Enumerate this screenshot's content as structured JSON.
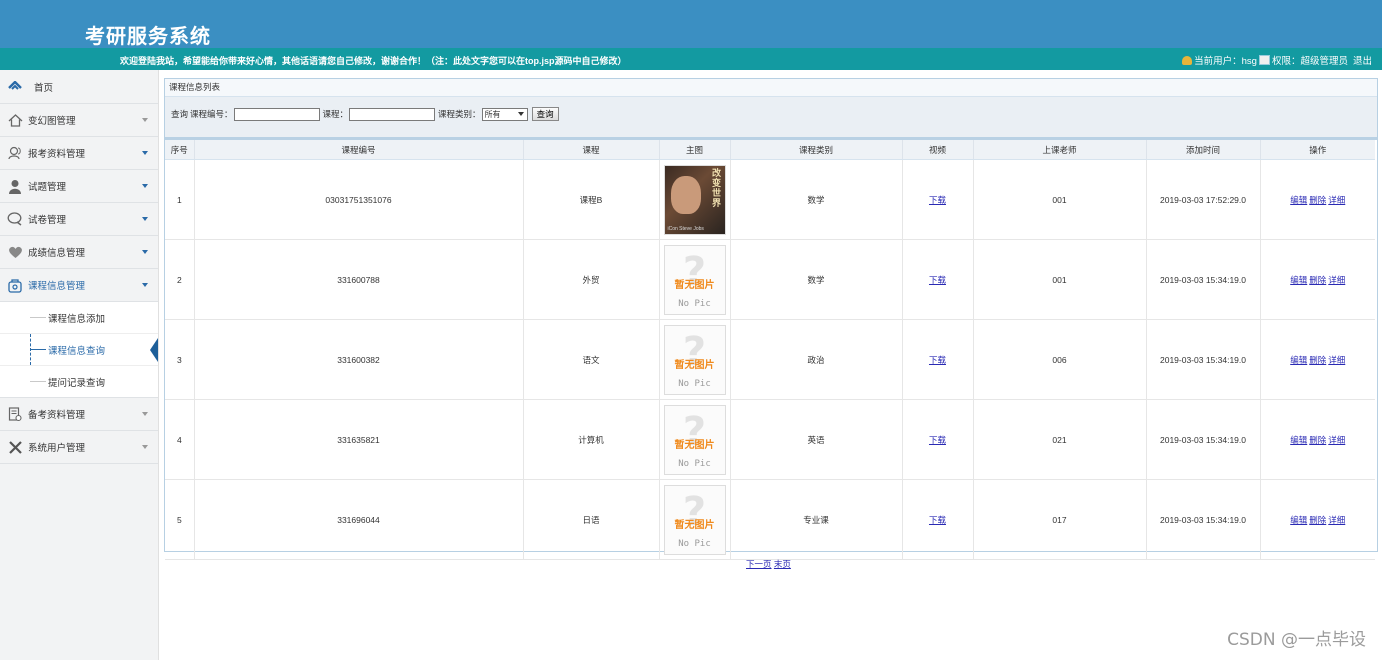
{
  "header": {
    "title": "考研服务系统",
    "welcome": "欢迎登陆我站，希望能给你带来好心情，其他话语请您自己修改，谢谢合作！（注：此处文字您可以在top.jsp源码中自己修改）",
    "user_text": "当前用户：hsg",
    "role_text": "权限：超级管理员",
    "logout": "退出"
  },
  "sidebar": {
    "home": "首页",
    "items": [
      {
        "label": "变幻图管理",
        "icon": "house-outline-icon"
      },
      {
        "label": "报考资料管理",
        "icon": "users-icon"
      },
      {
        "label": "试题管理",
        "icon": "person-icon"
      },
      {
        "label": "试卷管理",
        "icon": "chat-bubble-icon"
      },
      {
        "label": "成绩信息管理",
        "icon": "heart-icon"
      },
      {
        "label": "课程信息管理",
        "icon": "course-icon"
      },
      {
        "label": "备考资料管理",
        "icon": "document-icon"
      },
      {
        "label": "系统用户管理",
        "icon": "tools-icon"
      }
    ],
    "submenu": [
      "课程信息添加",
      "课程信息查询",
      "提问记录查询"
    ]
  },
  "panel": {
    "title": "课程信息列表",
    "search": {
      "query_label": "查询",
      "code_label": "课程编号：",
      "course_label": "课程：",
      "type_label": "课程类别：",
      "type_value": "所有",
      "button": "查询"
    }
  },
  "table": {
    "columns": [
      "序号",
      "课程编号",
      "课程",
      "主图",
      "课程类别",
      "视频",
      "上课老师",
      "添加时间",
      "操作"
    ],
    "rows": [
      {
        "no": "1",
        "code": "03031751351076",
        "course": "课程B",
        "type": "数学",
        "video": "下载",
        "teacher": "001",
        "time": "2019-03-03 17:52:29.0",
        "image": "photo"
      },
      {
        "no": "2",
        "code": "331600788",
        "course": "外贸",
        "type": "数学",
        "video": "下载",
        "teacher": "001",
        "time": "2019-03-03 15:34:19.0",
        "image": "nopic"
      },
      {
        "no": "3",
        "code": "331600382",
        "course": "语文",
        "type": "政治",
        "video": "下载",
        "teacher": "006",
        "time": "2019-03-03 15:34:19.0",
        "image": "nopic"
      },
      {
        "no": "4",
        "code": "331635821",
        "course": "计算机",
        "type": "英语",
        "video": "下载",
        "teacher": "021",
        "time": "2019-03-03 15:34:19.0",
        "image": "nopic"
      },
      {
        "no": "5",
        "code": "331696044",
        "course": "日语",
        "type": "专业课",
        "video": "下载",
        "teacher": "017",
        "time": "2019-03-03 15:34:19.0",
        "image": "nopic"
      }
    ],
    "actions": [
      "编辑",
      "删除",
      "详细"
    ],
    "photo_text": "改变世界",
    "photo_caption": "iCon Steve Jobs",
    "nopic_cn": "暂无图片",
    "nopic_en": "No Pic"
  },
  "pager": {
    "next": "下一页",
    "last": "末页"
  },
  "watermark": "CSDN @一点毕设",
  "colors": {
    "header": "#3b8fc2",
    "welcome_bar": "#139aa1",
    "link": "#2a2ab4",
    "sidebar_bg": "#f2f3f4"
  }
}
